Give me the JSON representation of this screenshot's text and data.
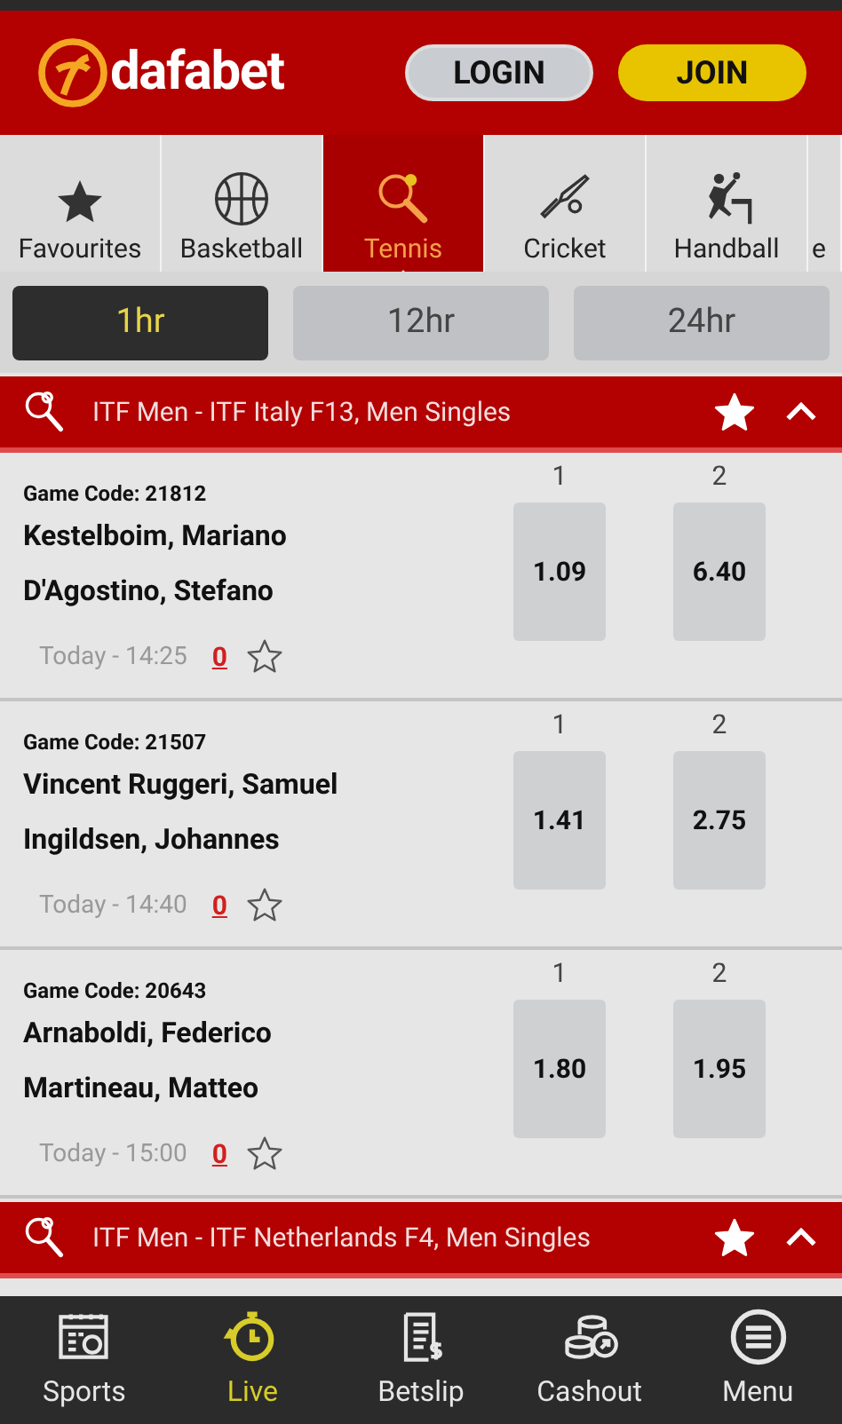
{
  "header": {
    "logo": "dafabet",
    "buttons": [
      {
        "kind": "login",
        "label": "LOGIN"
      },
      {
        "kind": "join",
        "label": "JOIN"
      }
    ]
  },
  "sports_tabs": [
    {
      "kind": "star",
      "label": "Favourites",
      "selected": false
    },
    {
      "kind": "basketball",
      "label": "Basketball",
      "selected": false
    },
    {
      "kind": "tennis",
      "label": "Tennis",
      "selected": true
    },
    {
      "kind": "cricket",
      "label": "Cricket",
      "selected": false
    },
    {
      "kind": "handball",
      "label": "Handball",
      "selected": false
    },
    {
      "kind": "cut",
      "label": "e",
      "selected": false
    }
  ],
  "time_filters": [
    {
      "label": "1hr",
      "selected": true
    },
    {
      "label": "12hr",
      "selected": false
    },
    {
      "label": "24hr",
      "selected": false
    }
  ],
  "leagues": [
    {
      "title": "ITF Men - ITF Italy F13, Men Singles",
      "matches": [
        {
          "code": "Game Code: 21812",
          "player_1": "Kestelboim, Mariano",
          "player_2": "D'Agostino, Stefano",
          "time": "Today - 14:25",
          "count": "0",
          "odds": [
            {
              "label": "1",
              "value": "1.09"
            },
            {
              "label": "2",
              "value": "6.40"
            }
          ]
        },
        {
          "code": "Game Code: 21507",
          "player_1": "Vincent Ruggeri, Samuel",
          "player_2": "Ingildsen, Johannes",
          "time": "Today - 14:40",
          "count": "0",
          "odds": [
            {
              "label": "1",
              "value": "1.41"
            },
            {
              "label": "2",
              "value": "2.75"
            }
          ]
        },
        {
          "code": "Game Code: 20643",
          "player_1": "Arnaboldi, Federico",
          "player_2": "Martineau, Matteo",
          "time": "Today - 15:00",
          "count": "0",
          "odds": [
            {
              "label": "1",
              "value": "1.80"
            },
            {
              "label": "2",
              "value": "1.95"
            }
          ]
        }
      ]
    },
    {
      "title": "ITF Men - ITF Netherlands F4, Men Singles"
    }
  ],
  "bottom_nav": [
    {
      "kind": "sports",
      "label": "Sports",
      "selected": false
    },
    {
      "kind": "live",
      "label": "Live",
      "selected": true
    },
    {
      "kind": "betslip",
      "label": "Betslip",
      "selected": false
    },
    {
      "kind": "cashout",
      "label": "Cashout",
      "selected": false
    },
    {
      "kind": "menu",
      "label": "Menu",
      "selected": false
    }
  ]
}
